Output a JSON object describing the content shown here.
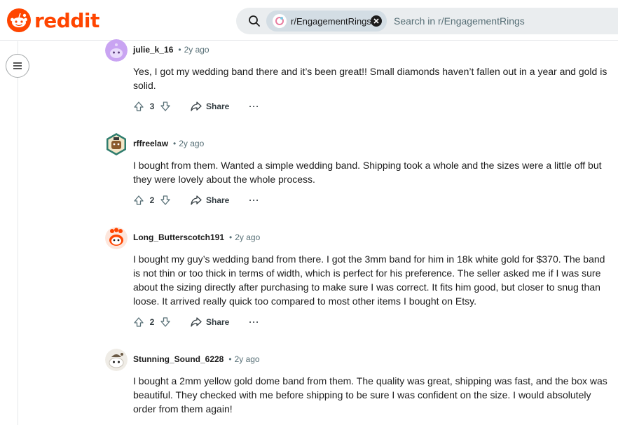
{
  "header": {
    "logo_text": "reddit",
    "subreddit_chip": "r/EngagementRings",
    "search_placeholder": "Search in r/EngagementRings",
    "brand_color": "#ff4500"
  },
  "comments": [
    {
      "username": "julie_k_16",
      "time": "2y ago",
      "body": "Yes, I got my wedding band there and it’s been great!! Small diamonds haven’t fallen out in a year and gold is solid.",
      "votes": "3",
      "share_label": "Share",
      "more_label": "···",
      "avatar_color": "#c9a4f2"
    },
    {
      "username": "rffreelaw",
      "time": "2y ago",
      "body": "I bought from them. Wanted a simple wedding band. Shipping took a whole and the sizes were a little off but they were lovely about the whole process.",
      "votes": "2",
      "share_label": "Share",
      "more_label": "···",
      "avatar_color": "#2f7d6e"
    },
    {
      "username": "Long_Butterscotch191",
      "time": "2y ago",
      "body": "I bought my guy’s wedding band from there. I got the 3mm band for him in 18k white gold for $370. The band is not thin or too thick in terms of width, which is perfect for his preference. The seller asked me if I was sure about the sizing directly after purchasing to make sure I was correct. It fits him good, but closer to snug than loose. It arrived really quick too compared to most other items I bought on Etsy.",
      "votes": "2",
      "share_label": "Share",
      "more_label": "···",
      "avatar_color": "#ff4500"
    },
    {
      "username": "Stunning_Sound_6228",
      "time": "2y ago",
      "body": "I bought a 2mm yellow gold dome band from them. The quality was great, shipping was fast, and the box was beautiful. They checked with me before shipping to be sure I was confident on the size. I would absolutely order from them again!",
      "votes": "",
      "share_label": "",
      "more_label": "",
      "avatar_color": "#d9d4cc"
    }
  ]
}
